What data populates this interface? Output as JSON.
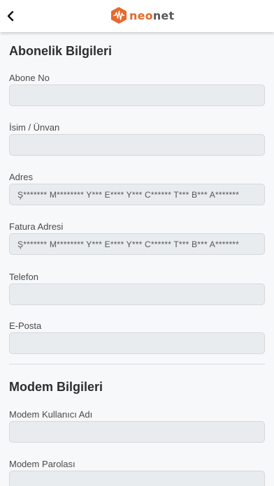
{
  "header": {
    "back_icon": "chevron-left-icon",
    "logo_icon": "neonet-hexagon-icon",
    "logo_text_accent": "neo",
    "logo_text_rest": "net",
    "brand_color": "#e56a2c"
  },
  "subscription": {
    "title": "Abonelik Bilgileri",
    "subscriber_no": {
      "label": "Abone No",
      "value": ""
    },
    "name": {
      "label": "İsim / Ünvan",
      "value": ""
    },
    "address": {
      "label": "Adres",
      "value": "Ş******* M******** Y*** E**** Y*** C****** T*** B*** A*******"
    },
    "invoice_address": {
      "label": "Fatura Adresi",
      "value": "Ş******* M******** Y*** E**** Y*** C****** T*** B*** A*******"
    },
    "phone": {
      "label": "Telefon",
      "value": ""
    },
    "email": {
      "label": "E-Posta",
      "value": ""
    }
  },
  "modem": {
    "title": "Modem Bilgileri",
    "username": {
      "label": "Modem Kullanıcı Adı",
      "value": ""
    },
    "password": {
      "label": "Modem Parolası",
      "value": ""
    }
  }
}
